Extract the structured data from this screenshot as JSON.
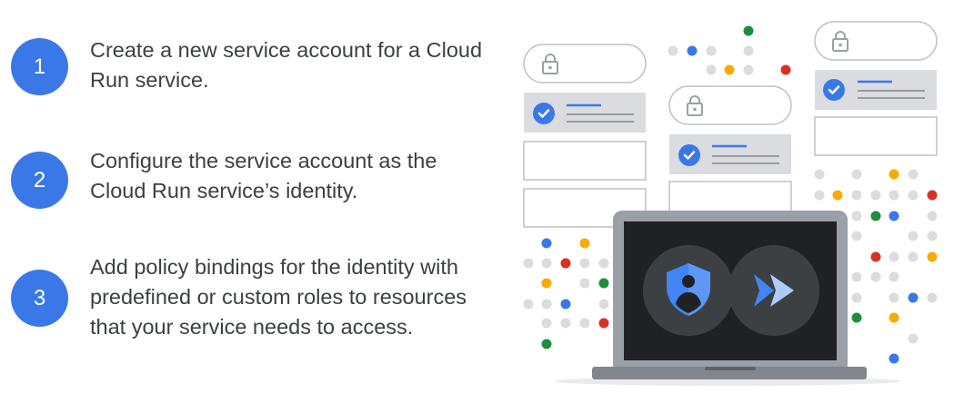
{
  "steps": [
    {
      "number": "1",
      "text": "Create a new service account for a Cloud Run service."
    },
    {
      "number": "2",
      "text": "Configure the service account as the Cloud Run service’s identity."
    },
    {
      "number": "3",
      "text": "Add policy bindings for the identity with predefined or custom roles to resources that your service needs to access."
    }
  ],
  "colors": {
    "accent_blue": "#3b78e7",
    "green": "#1e8e3e",
    "yellow": "#f9ab00",
    "red": "#d93025",
    "gray_dot": "#dadce0",
    "laptop_screen": "#202124",
    "laptop_frame": "#9aa0a6"
  },
  "icons": {
    "lock": "lock-icon",
    "check": "check-circle-icon",
    "identity": "shield-person-icon",
    "cloud_run": "cloud-run-icon"
  }
}
